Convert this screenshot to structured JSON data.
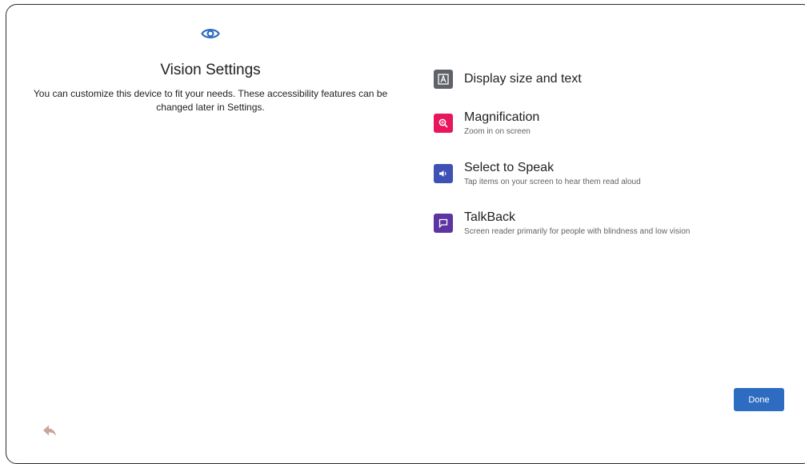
{
  "header": {
    "icon": "eye-icon",
    "title": "Vision Settings",
    "description": "You can customize this device to fit your needs. These accessibility features can be changed later in Settings."
  },
  "options": [
    {
      "icon": "text-size-icon",
      "color": "#5f6368",
      "label": "Display size and text",
      "subtitle": ""
    },
    {
      "icon": "magnify-icon",
      "color": "#e8175d",
      "label": "Magnification",
      "subtitle": "Zoom in on screen"
    },
    {
      "icon": "speaker-icon",
      "color": "#3f51b5",
      "label": "Select to Speak",
      "subtitle": "Tap items on your screen to hear them read aloud"
    },
    {
      "icon": "talkback-icon",
      "color": "#5c35a3",
      "label": "TalkBack",
      "subtitle": "Screen reader primarily for people with blindness and low vision"
    }
  ],
  "footer": {
    "done_label": "Done",
    "back_icon": "back-arrow-icon"
  },
  "colors": {
    "accent": "#2d6cc0",
    "back_icon": "#c8a79a"
  }
}
